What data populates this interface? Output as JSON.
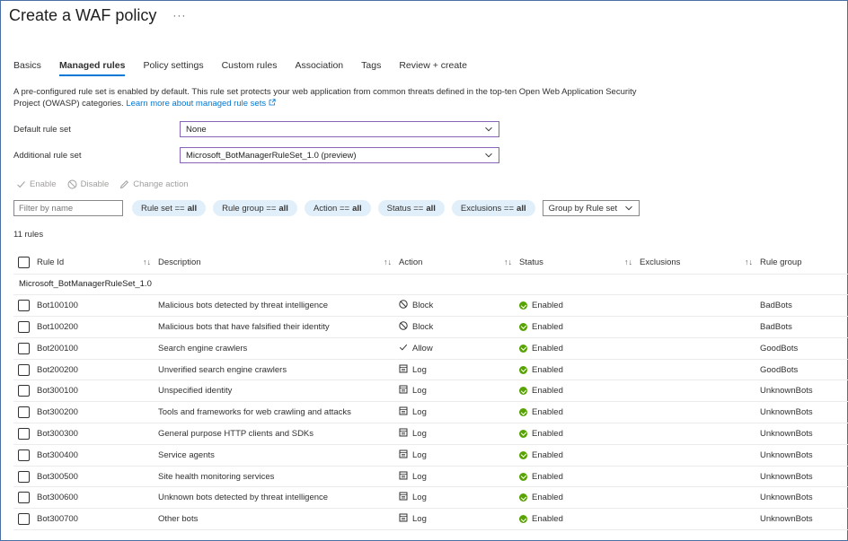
{
  "header": {
    "title": "Create a WAF policy",
    "more": "···"
  },
  "tabs": [
    "Basics",
    "Managed rules",
    "Policy settings",
    "Custom rules",
    "Association",
    "Tags",
    "Review + create"
  ],
  "description": {
    "text": "A pre-configured rule set is enabled by default. This rule set protects your web application from common threats defined in the top-ten Open Web Application Security Project (OWASP) categories. ",
    "link": "Learn more about managed rule sets"
  },
  "form": {
    "default_rule_set_label": "Default rule set",
    "default_rule_set_value": "None",
    "additional_rule_set_label": "Additional rule set",
    "additional_rule_set_value": "Microsoft_BotManagerRuleSet_1.0 (preview)"
  },
  "toolbar": {
    "enable": "Enable",
    "disable": "Disable",
    "change_action": "Change action"
  },
  "filters": {
    "placeholder": "Filter by name",
    "pills": [
      {
        "label": "Rule set ==",
        "value": "all"
      },
      {
        "label": "Rule group ==",
        "value": "all"
      },
      {
        "label": "Action ==",
        "value": "all"
      },
      {
        "label": "Status ==",
        "value": "all"
      },
      {
        "label": "Exclusions ==",
        "value": "all"
      }
    ],
    "group_by": "Group by Rule set"
  },
  "count": "11 rules",
  "table": {
    "columns": [
      "Rule Id",
      "Description",
      "Action",
      "Status",
      "Exclusions",
      "Rule group"
    ],
    "group_name": "Microsoft_BotManagerRuleSet_1.0",
    "rows": [
      {
        "id": "Bot100100",
        "description": "Malicious bots detected by threat intelligence",
        "action": "Block",
        "action_icon": "block-icon",
        "status": "Enabled",
        "group": "BadBots"
      },
      {
        "id": "Bot100200",
        "description": "Malicious bots that have falsified their identity",
        "action": "Block",
        "action_icon": "block-icon",
        "status": "Enabled",
        "group": "BadBots"
      },
      {
        "id": "Bot200100",
        "description": "Search engine crawlers",
        "action": "Allow",
        "action_icon": "check-icon",
        "status": "Enabled",
        "group": "GoodBots"
      },
      {
        "id": "Bot200200",
        "description": "Unverified search engine crawlers",
        "action": "Log",
        "action_icon": "log-icon",
        "status": "Enabled",
        "group": "GoodBots"
      },
      {
        "id": "Bot300100",
        "description": "Unspecified identity",
        "action": "Log",
        "action_icon": "log-icon",
        "status": "Enabled",
        "group": "UnknownBots"
      },
      {
        "id": "Bot300200",
        "description": "Tools and frameworks for web crawling and attacks",
        "action": "Log",
        "action_icon": "log-icon",
        "status": "Enabled",
        "group": "UnknownBots"
      },
      {
        "id": "Bot300300",
        "description": "General purpose HTTP clients and SDKs",
        "action": "Log",
        "action_icon": "log-icon",
        "status": "Enabled",
        "group": "UnknownBots"
      },
      {
        "id": "Bot300400",
        "description": "Service agents",
        "action": "Log",
        "action_icon": "log-icon",
        "status": "Enabled",
        "group": "UnknownBots"
      },
      {
        "id": "Bot300500",
        "description": "Site health monitoring services",
        "action": "Log",
        "action_icon": "log-icon",
        "status": "Enabled",
        "group": "UnknownBots"
      },
      {
        "id": "Bot300600",
        "description": "Unknown bots detected by threat intelligence",
        "action": "Log",
        "action_icon": "log-icon",
        "status": "Enabled",
        "group": "UnknownBots"
      },
      {
        "id": "Bot300700",
        "description": "Other bots",
        "action": "Log",
        "action_icon": "log-icon",
        "status": "Enabled",
        "group": "UnknownBots"
      }
    ]
  },
  "colors": {
    "accent": "#0078d4",
    "success": "#57a300",
    "pill_bg": "#e1effa",
    "select_border": "#8764b8"
  }
}
